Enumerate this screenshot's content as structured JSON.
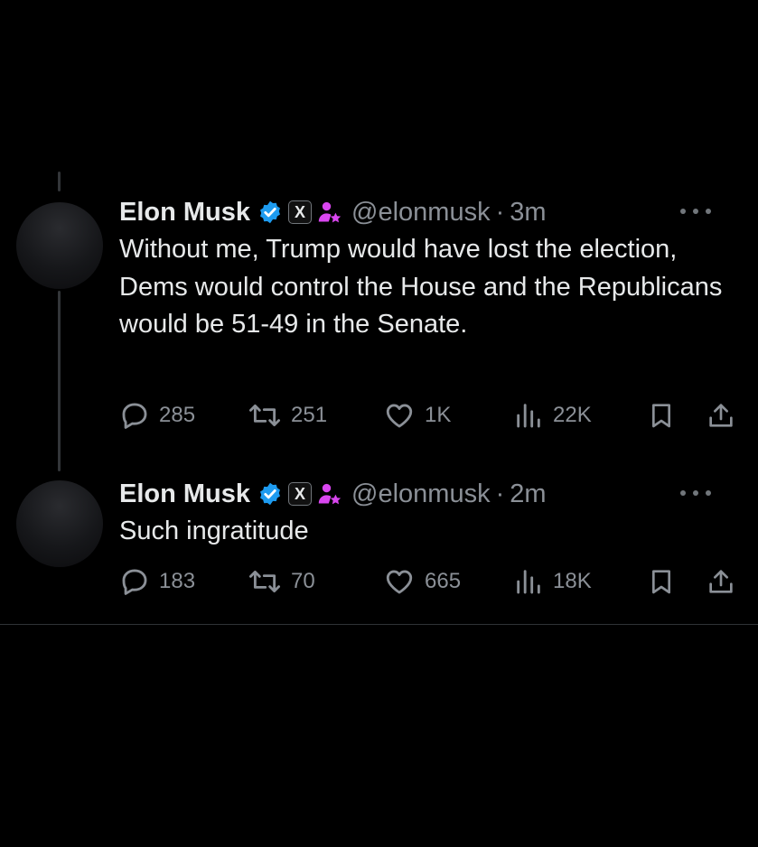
{
  "tweets": [
    {
      "author": {
        "name": "Elon Musk",
        "handle": "@elonmusk",
        "affiliation_badge": "X"
      },
      "separator": "·",
      "time": "3m",
      "text": "Without me, Trump would have lost the election, Dems would control the House and the Republicans would be 51-49 in the Senate.",
      "stats": {
        "replies": "285",
        "reposts": "251",
        "likes": "1K",
        "views": "22K"
      }
    },
    {
      "author": {
        "name": "Elon Musk",
        "handle": "@elonmusk",
        "affiliation_badge": "X"
      },
      "separator": "·",
      "time": "2m",
      "text": "Such ingratitude",
      "stats": {
        "replies": "183",
        "reposts": "70",
        "likes": "665",
        "views": "18K"
      }
    }
  ],
  "colors": {
    "background": "#000000",
    "text_primary": "#e7e9ea",
    "text_secondary": "#8b9097",
    "verified_badge": "#1d9bf0",
    "role_icon": "#d946ef",
    "thread_line": "#333639"
  },
  "icons": [
    "verified-badge-icon",
    "x-affiliation-icon",
    "role-person-icon",
    "more-icon",
    "reply-icon",
    "repost-icon",
    "like-icon",
    "views-icon",
    "bookmark-icon",
    "share-icon"
  ]
}
